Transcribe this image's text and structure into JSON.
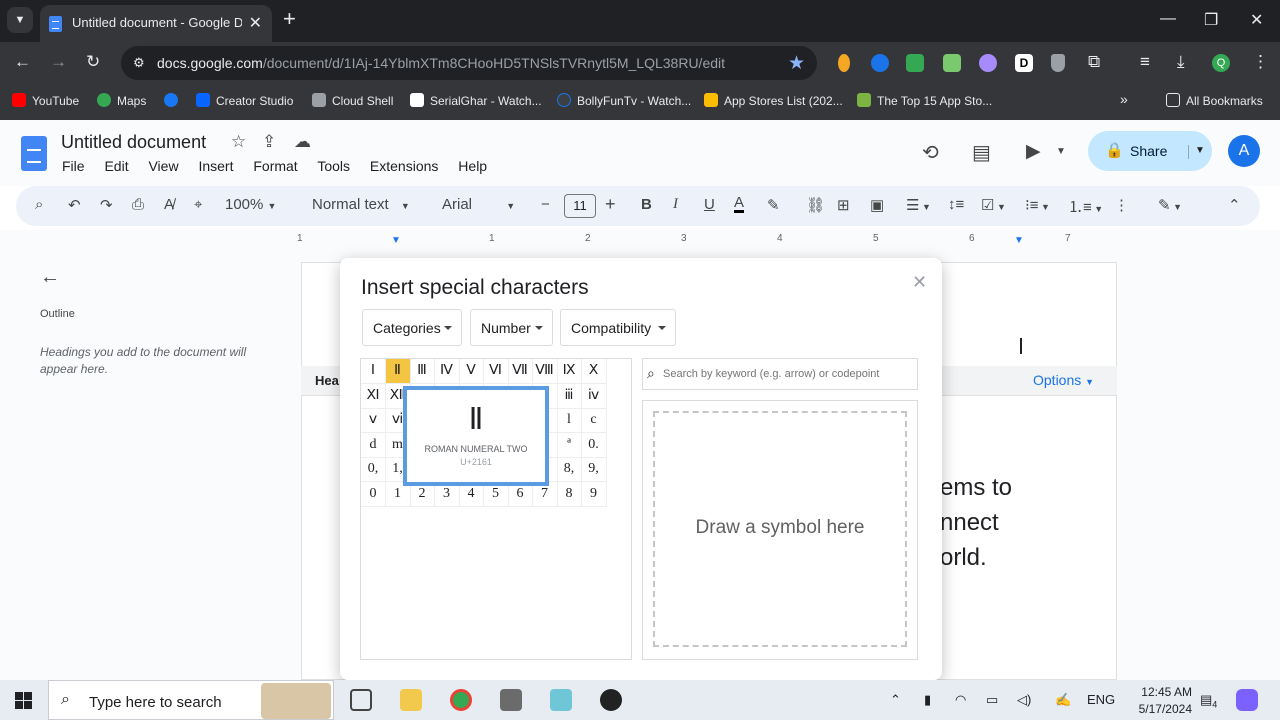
{
  "browser": {
    "tab_title": "Untitled document - Google Docs",
    "url_host": "docs.google.com",
    "url_path": "/document/d/1IAj-14YblmXTm8CHooHD5TNSlsTVRnytl5M_LQL38RU/edit",
    "bookmarks": [
      "YouTube",
      "Maps",
      "",
      "Creator Studio",
      "Cloud Shell",
      "SerialGhar - Watch...",
      "BollyFunTv - Watch...",
      "App Stores List (202...",
      "The Top 15 App Sto..."
    ],
    "all_bookmarks": "All Bookmarks"
  },
  "docs": {
    "title": "Untitled document",
    "menus": [
      "File",
      "Edit",
      "View",
      "Insert",
      "Format",
      "Tools",
      "Extensions",
      "Help"
    ],
    "share_label": "Share",
    "avatar_letter": "A",
    "toolbar": {
      "zoom": "100%",
      "style": "Normal text",
      "font": "Arial",
      "font_size": "11"
    },
    "ruler_marks": [
      "1",
      "1",
      "2",
      "3",
      "4",
      "5",
      "6",
      "7"
    ]
  },
  "outline": {
    "title": "Outline",
    "hint": "Headings you add to the document will appear here."
  },
  "page": {
    "heading_partial": "Hea",
    "options_label": "Options",
    "body_lines": [
      "ems to",
      "nnect",
      "orld."
    ]
  },
  "dialog": {
    "title": "Insert special characters",
    "dropdowns": [
      "Categories",
      "Number",
      "Compatibility"
    ],
    "grid_rows": [
      [
        "Ⅰ",
        "Ⅱ",
        "Ⅲ",
        "Ⅳ",
        "Ⅴ",
        "Ⅵ",
        "Ⅶ",
        "Ⅷ",
        "Ⅸ",
        "Ⅹ"
      ],
      [
        "Ⅺ",
        "Ⅻ",
        "",
        "",
        "",
        "",
        "",
        "",
        "ⅲ",
        "ⅳ"
      ],
      [
        "ⅴ",
        "ⅵ",
        "",
        "",
        "",
        "",
        "",
        "ⅰ",
        "l",
        "c"
      ],
      [
        "d",
        "m",
        "",
        "",
        "",
        "",
        "",
        "",
        "ª",
        "0."
      ],
      [
        "0,",
        "1,",
        "",
        "",
        "",
        "",
        "",
        "",
        "8,",
        "9,"
      ],
      [
        "0",
        "1",
        "2",
        "3",
        "4",
        "5",
        "6",
        "7",
        "8",
        "9"
      ]
    ],
    "preview": {
      "glyph": "Ⅱ",
      "name": "ROMAN NUMERAL TWO",
      "code": "U+2161"
    },
    "search_placeholder": "Search by keyword (e.g. arrow) or codepoint",
    "draw_label": "Draw a symbol here"
  },
  "taskbar": {
    "search_text": "Type here to search",
    "lang": "ENG",
    "time": "12:45 AM",
    "date": "5/17/2024",
    "notification_count": "4"
  }
}
